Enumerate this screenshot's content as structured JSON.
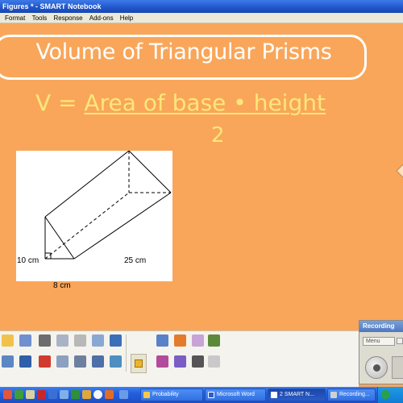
{
  "window": {
    "title": "Figures * - SMART Notebook"
  },
  "menu": {
    "items": [
      "Format",
      "Tools",
      "Response",
      "Add-ons",
      "Help"
    ]
  },
  "slide": {
    "title": "Volume of Triangular Prisms",
    "formula": {
      "prefix": "V = ",
      "numerator": "Area of base • height",
      "denominator": "2"
    },
    "figure": {
      "height_label": "10 cm",
      "length_label": "25 cm",
      "base_label": "8 cm"
    }
  },
  "recording_panel": {
    "title": "Recording",
    "menu_label": "Menu"
  },
  "taskbar": {
    "items": [
      {
        "label": "Probability",
        "icon": "folder-icon",
        "color": "#f2c94c"
      },
      {
        "label": "Microsoft Word",
        "icon": "word-icon",
        "color": "#2b5fc9"
      },
      {
        "label": "2 SMART N...",
        "icon": "smart-notebook-icon",
        "color": "#ffffff"
      },
      {
        "label": "Recording...",
        "icon": "recorder-icon",
        "color": "#d0d0d0"
      }
    ]
  },
  "colors": {
    "canvas": "#f9a65a",
    "title_text": "#ffffff",
    "formula_text": "#fbe77a"
  }
}
